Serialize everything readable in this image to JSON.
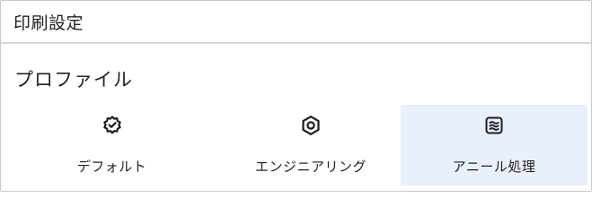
{
  "header": {
    "title": "印刷設定"
  },
  "section": {
    "title": "プロファイル"
  },
  "options": [
    {
      "label": "デフォルト",
      "icon": "gear-check-icon",
      "selected": false
    },
    {
      "label": "エンジニアリング",
      "icon": "hex-nut-icon",
      "selected": false
    },
    {
      "label": "アニール処理",
      "icon": "heat-waves-icon",
      "selected": true
    }
  ],
  "colors": {
    "selected_background": "#e9effb",
    "icon": "#1c1c1c",
    "border": "#c9c9c9"
  }
}
